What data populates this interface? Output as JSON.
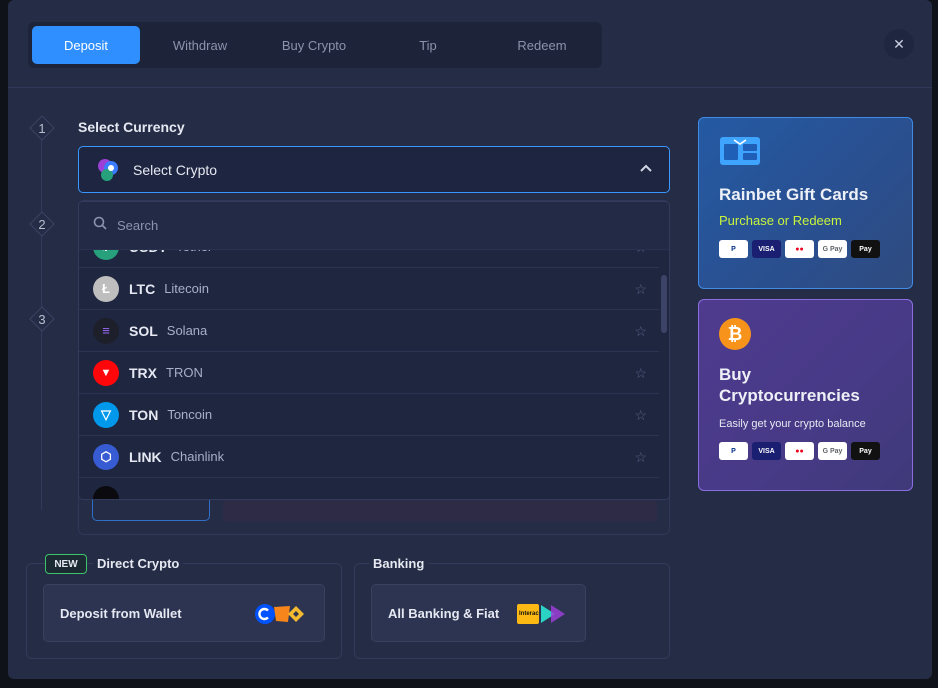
{
  "tabs": [
    {
      "label": "Deposit",
      "active": true
    },
    {
      "label": "Withdraw"
    },
    {
      "label": "Buy Crypto"
    },
    {
      "label": "Tip"
    },
    {
      "label": "Redeem"
    }
  ],
  "close_icon": "close-icon",
  "steps": [
    "1",
    "2",
    "3"
  ],
  "select_currency": {
    "title": "Select Currency",
    "placeholder": "Select Crypto",
    "chevron": "chevron-up-icon"
  },
  "search": {
    "placeholder": "Search",
    "icon": "search-icon"
  },
  "coins": [
    {
      "ticker": "USDT",
      "name": "Tether",
      "color": "#26a17b",
      "glyph": "₮"
    },
    {
      "ticker": "LTC",
      "name": "Litecoin",
      "color": "#bebebe",
      "glyph": "Ł"
    },
    {
      "ticker": "SOL",
      "name": "Solana",
      "color": "#1d1f2b",
      "glyph": "≡"
    },
    {
      "ticker": "TRX",
      "name": "TRON",
      "color": "#ff060a",
      "glyph": "▼"
    },
    {
      "ticker": "TON",
      "name": "Toncoin",
      "color": "#0098ea",
      "glyph": "▽"
    },
    {
      "ticker": "LINK",
      "name": "Chainlink",
      "color": "#375bd2",
      "glyph": "⬡"
    }
  ],
  "gift_card": {
    "title": "Rainbet Gift Cards",
    "subtitle": "Purchase or Redeem",
    "payments": [
      "P",
      "VISA",
      "●●",
      "G Pay",
      "Pay"
    ]
  },
  "buy_crypto": {
    "title": "Buy Cryptocurrencies",
    "subtitle": "Easily get your crypto balance",
    "payments": [
      "P",
      "VISA",
      "●●",
      "G Pay",
      "Pay"
    ]
  },
  "direct_crypto": {
    "badge": "NEW",
    "title": "Direct Crypto",
    "button": "Deposit from Wallet"
  },
  "banking": {
    "title": "Banking",
    "button": "All Banking & Fiat"
  },
  "colors": {
    "accent": "#2f8fff",
    "modal_bg": "#252c45",
    "promo_green": "#c8f53a"
  }
}
